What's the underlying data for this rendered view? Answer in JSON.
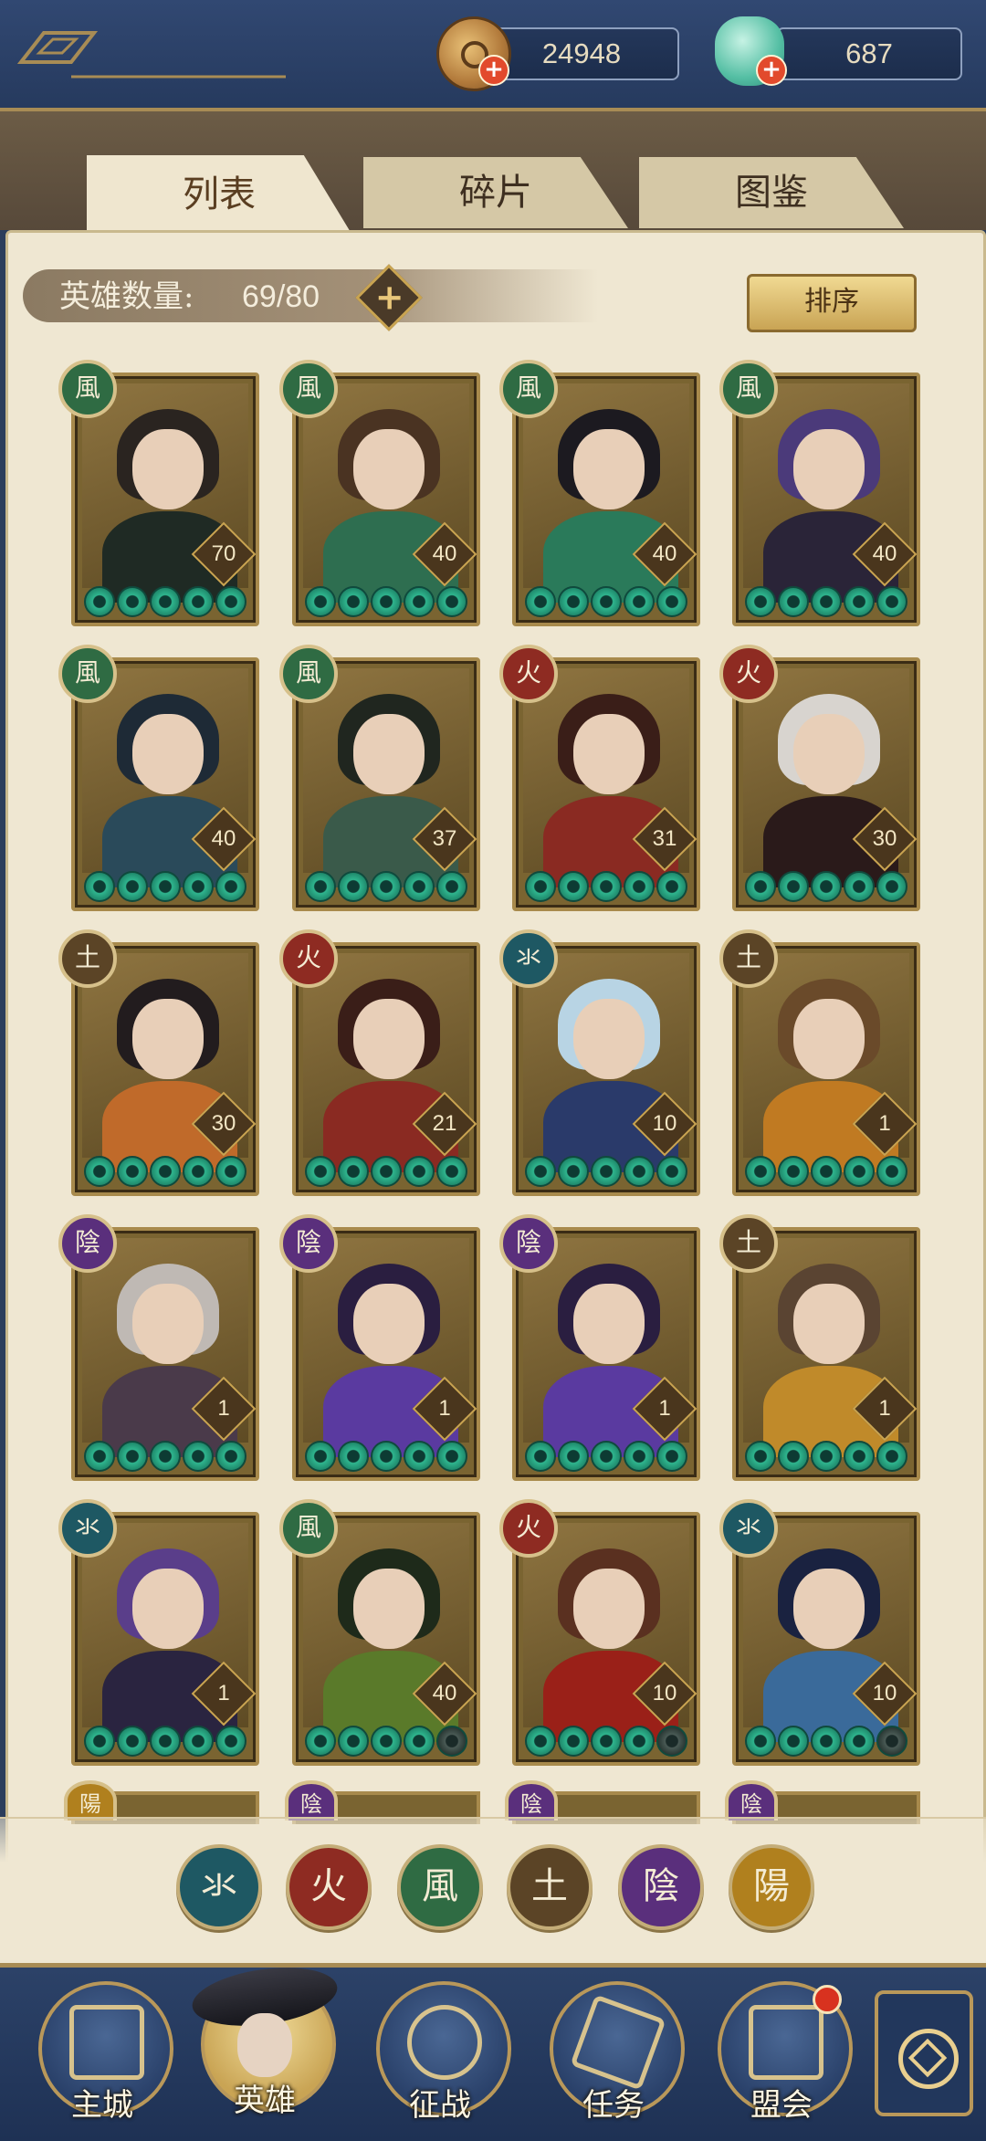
{
  "currency": {
    "coins": "24948",
    "jade": "687"
  },
  "tabs": {
    "list": "列表",
    "fragments": "碎片",
    "atlas": "图鉴"
  },
  "hero_count": {
    "label": "英雄数量:",
    "value": "69/80"
  },
  "sort_label": "排序",
  "elements": {
    "water": "氺",
    "fire": "火",
    "wind": "風",
    "earth": "土",
    "yin": "陰",
    "yang": "陽"
  },
  "heroes": [
    {
      "element": "風",
      "level": "70",
      "stars": 5
    },
    {
      "element": "風",
      "level": "40",
      "stars": 5
    },
    {
      "element": "風",
      "level": "40",
      "stars": 5
    },
    {
      "element": "風",
      "level": "40",
      "stars": 5
    },
    {
      "element": "風",
      "level": "40",
      "stars": 5
    },
    {
      "element": "風",
      "level": "37",
      "stars": 5
    },
    {
      "element": "火",
      "level": "31",
      "stars": 5
    },
    {
      "element": "火",
      "level": "30",
      "stars": 5
    },
    {
      "element": "土",
      "level": "30",
      "stars": 5
    },
    {
      "element": "火",
      "level": "21",
      "stars": 5
    },
    {
      "element": "氺",
      "level": "10",
      "stars": 5
    },
    {
      "element": "土",
      "level": "1",
      "stars": 5
    },
    {
      "element": "陰",
      "level": "1",
      "stars": 5
    },
    {
      "element": "陰",
      "level": "1",
      "stars": 5
    },
    {
      "element": "陰",
      "level": "1",
      "stars": 5
    },
    {
      "element": "土",
      "level": "1",
      "stars": 5
    },
    {
      "element": "氺",
      "level": "1",
      "stars": 5
    },
    {
      "element": "風",
      "level": "40",
      "stars": 4
    },
    {
      "element": "火",
      "level": "10",
      "stars": 4
    },
    {
      "element": "氺",
      "level": "10",
      "stars": 4
    }
  ],
  "peek_row": [
    "陽",
    "陰",
    "陰",
    "陰"
  ],
  "nav": {
    "city": "主城",
    "hero": "英雄",
    "battle": "征战",
    "quest": "任务",
    "alliance": "盟会"
  },
  "colors": {
    "wind": "#2f6b43",
    "fire": "#8e2b22",
    "earth": "#5b4426",
    "water": "#1e5863",
    "yin": "#5a2f7c",
    "yang": "#b0801e"
  }
}
